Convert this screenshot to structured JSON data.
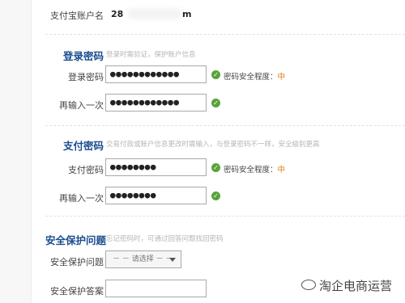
{
  "account": {
    "label": "支付宝账户名",
    "value_start": "28",
    "value_end": "m"
  },
  "login": {
    "title": "登录密码",
    "hint": "登录时需验证，保护账户信息",
    "password_label": "登录密码",
    "password_value": "●●●●●●●●●●●●",
    "strength_label": "密码安全程度：",
    "strength_level": "中",
    "confirm_label": "再输入一次",
    "confirm_value": "●●●●●●●●●●●●"
  },
  "pay": {
    "title": "支付密码",
    "hint": "交易付款或账户信息更改时需输入，与登录密码不一样，安全级别更高",
    "password_label": "支付密码",
    "password_value": "●●●●●●●●",
    "strength_label": "密码安全程度：",
    "strength_level": "中",
    "confirm_label": "再输入一次",
    "confirm_value": "●●●●●●●●"
  },
  "security": {
    "title": "安全保护问题",
    "hint": "忘记密码时，可通过回答问题找回密码",
    "question_label": "安全保护问题",
    "question_select": "－ － 请选择 － －",
    "answer_label": "安全保护答案",
    "answer_value": ""
  },
  "watermark": {
    "text": "淘企电商运营"
  },
  "colors": {
    "title": "#1a4c8f",
    "ok": "#5aa33a",
    "level": "#e07b14"
  }
}
